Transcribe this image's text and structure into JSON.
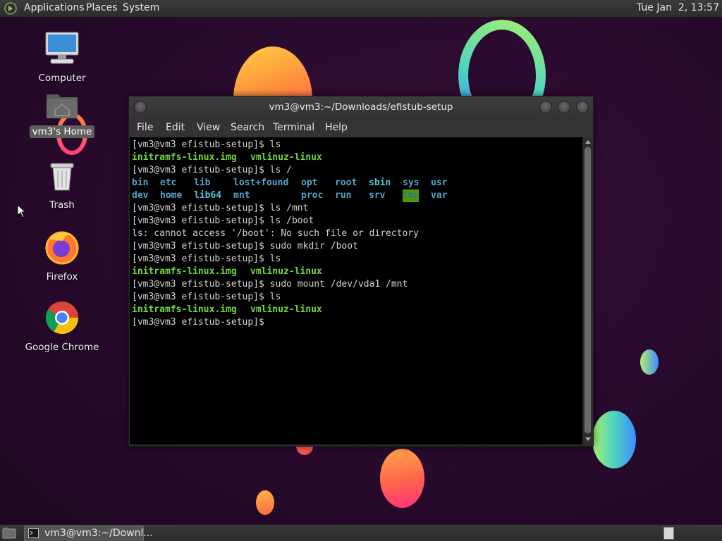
{
  "top_panel": {
    "menus": [
      "Applications",
      "Places",
      "System"
    ],
    "clock": "Tue Jan  2, 13:57"
  },
  "desktop": {
    "icons": [
      {
        "label": "Computer",
        "icon": "computer-icon"
      },
      {
        "label": "vm3's Home",
        "icon": "home-folder-icon",
        "selected": true
      },
      {
        "label": "Trash",
        "icon": "trash-icon"
      },
      {
        "label": "Firefox",
        "icon": "firefox-icon"
      },
      {
        "label": "Google Chrome",
        "icon": "chrome-icon"
      }
    ]
  },
  "terminal": {
    "title": "vm3@vm3:~/Downloads/efistub-setup",
    "menu": [
      "File",
      "Edit",
      "View",
      "Search",
      "Terminal",
      "Help"
    ],
    "prompt": "[vm3@vm3 efistub-setup]$",
    "lines": {
      "l1": "[vm3@vm3 efistub-setup]$ ls",
      "l2a": "initramfs-linux.img",
      "l2b": "vmlinuz-linux",
      "l3": "[vm3@vm3 efistub-setup]$ ls /",
      "l4": [
        "bin",
        "etc",
        "lib",
        "lost+found",
        "opt",
        "root",
        "sbin",
        "sys",
        "usr"
      ],
      "l5": [
        "dev",
        "home",
        "lib64",
        "mnt",
        "proc",
        "run",
        "srv",
        "tmp",
        "var"
      ],
      "l6": "[vm3@vm3 efistub-setup]$ ls /mnt",
      "l7": "[vm3@vm3 efistub-setup]$ ls /boot",
      "l8": "ls: cannot access '/boot': No such file or directory",
      "l9": "[vm3@vm3 efistub-setup]$ sudo mkdir /boot",
      "l10": "[vm3@vm3 efistub-setup]$ ls",
      "l11a": "initramfs-linux.img",
      "l11b": "vmlinuz-linux",
      "l12": "[vm3@vm3 efistub-setup]$ sudo mount /dev/vda1 /mnt",
      "l13": "[vm3@vm3 efistub-setup]$ ls",
      "l14a": "initramfs-linux.img",
      "l14b": "vmlinuz-linux",
      "l15": "[vm3@vm3 efistub-setup]$"
    },
    "colors": {
      "executable": "#6fd93a",
      "directory": "#54a3c9",
      "sticky_dir_bg": "#4e9a06"
    }
  },
  "taskbar": {
    "window_label": "vm3@vm3:~/Downl..."
  }
}
